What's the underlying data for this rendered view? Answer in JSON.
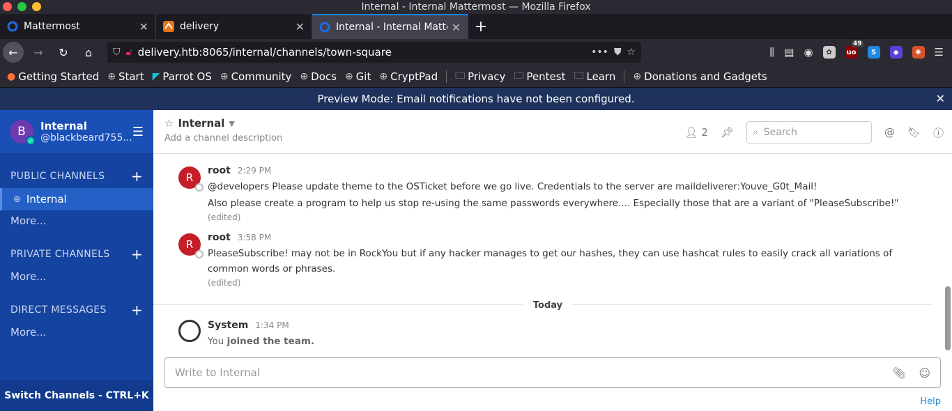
{
  "window": {
    "title": "Internal - Internal Mattermost — Mozilla Firefox"
  },
  "tabs": [
    {
      "title": "Mattermost",
      "icon": "mattermost-icon"
    },
    {
      "title": "delivery",
      "icon": "delivery-icon"
    },
    {
      "title": "Internal - Internal Matter",
      "icon": "mattermost-icon"
    }
  ],
  "urlbar": {
    "url": "delivery.htb:8065/internal/channels/town-square"
  },
  "extensions": {
    "ublock_badge": "49"
  },
  "bookmarks": [
    "Getting Started",
    "Start",
    "Parrot OS",
    "Community",
    "Docs",
    "Git",
    "CryptPad",
    "Privacy",
    "Pentest",
    "Learn",
    "Donations and Gadgets"
  ],
  "banner": {
    "text": "Preview Mode: Email notifications have not been configured."
  },
  "sidebar": {
    "avatar_letter": "B",
    "team_name": "Internal",
    "username": "@blackbeard755...",
    "public_header": "PUBLIC CHANNELS",
    "active_channel": "Internal",
    "more": "More...",
    "private_header": "PRIVATE CHANNELS",
    "direct_header": "DIRECT MESSAGES",
    "switch": "Switch Channels - CTRL+K"
  },
  "channel": {
    "name": "Internal",
    "description": "Add a channel description",
    "member_count": "2",
    "search_placeholder": "Search"
  },
  "posts": [
    {
      "author": "root",
      "avatar": "R",
      "time": "2:29 PM",
      "lines": [
        "@developers Please update theme to the OSTicket before we go live.  Credentials to the server are maildeliverer:Youve_G0t_Mail!",
        "Also please create a program to help us stop re-using the same passwords everywhere.... Especially those that are a variant of \"PleaseSubscribe!\""
      ],
      "edited": "(edited)"
    },
    {
      "author": "root",
      "avatar": "R",
      "time": "3:58 PM",
      "lines": [
        "PleaseSubscribe! may not be in RockYou but if any hacker manages to get our hashes, they can use hashcat rules to easily crack all variations of common words or phrases."
      ],
      "edited": "(edited)"
    }
  ],
  "day_separator": "Today",
  "system_post": {
    "author": "System",
    "time": "1:34 PM",
    "text_prefix": "You",
    "text_bold": "joined the team."
  },
  "composer": {
    "placeholder": "Write to Internal"
  },
  "help_label": "Help"
}
